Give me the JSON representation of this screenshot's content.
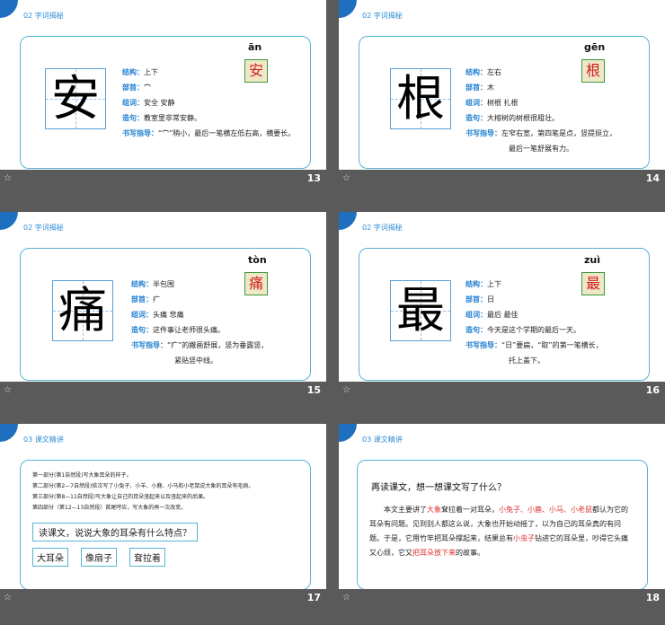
{
  "slides": [
    {
      "header": "02  字词揭秘",
      "char": "安",
      "pinyin": "ān",
      "rows": [
        {
          "label": "结构：",
          "value": "上下"
        },
        {
          "label": "部首：",
          "value": "宀"
        },
        {
          "label": "组词：",
          "value": "安全  安静"
        },
        {
          "label": "造句：",
          "value": "教室里非常安静。"
        },
        {
          "label": "书写指导：",
          "value": "“宀”稍小，最后一笔横左低右高，横要长。"
        }
      ],
      "page": "13"
    },
    {
      "header": "02  字词揭秘",
      "char": "根",
      "pinyin": "gēn",
      "rows": [
        {
          "label": "结构：",
          "value": "左右"
        },
        {
          "label": "部首：",
          "value": "木"
        },
        {
          "label": "组词：",
          "value": "树根  扎根"
        },
        {
          "label": "造句：",
          "value": "大榕树的树根很粗壮。"
        },
        {
          "label": "书写指导：",
          "value": "左窄右宽，第四笔是点，竖提挺立，"
        }
      ],
      "extra": "最后一笔舒展有力。",
      "page": "14"
    },
    {
      "header": "02  字词揭秘",
      "char": "痛",
      "pinyin": "tòn",
      "rows": [
        {
          "label": "结构：",
          "value": "半包围"
        },
        {
          "label": "部首：",
          "value": "疒"
        },
        {
          "label": "组词：",
          "value": "头痛  悲痛"
        },
        {
          "label": "造句：",
          "value": "这件事让老师很头痛。"
        },
        {
          "label": "书写指导：",
          "value": "“疒”的撇画舒展，竖为垂露竖，"
        }
      ],
      "extra": "紧贴竖中线。",
      "page": "15"
    },
    {
      "header": "02  字词揭秘",
      "char": "最",
      "pinyin": "zuì",
      "rows": [
        {
          "label": "结构：",
          "value": "上下"
        },
        {
          "label": "部首：",
          "value": "日"
        },
        {
          "label": "组词：",
          "value": "最后  最佳"
        },
        {
          "label": "造句：",
          "value": "今天是这个学期的最后一天。"
        },
        {
          "label": "书写指导：",
          "value": "“日”要扁，“取”的第一笔横长，"
        }
      ],
      "extra": "托上盖下。",
      "page": "16"
    }
  ],
  "slide17": {
    "header": "03  课文精讲",
    "parts": [
      "第一部分(第1自然段)写大象耳朵的样子。",
      "第二部分(第2—7自然段)依次写了小兔子、小羊、小鹿、小马和小老鼠说大象的耳朵有毛病。",
      "第三部分(第8—11自然段)写大象让自己的耳朵竖起来以及竖起来的后果。",
      "第四部分（第12—13自然段）首尾呼应，写大象的再一次改变。"
    ],
    "question": "读课文，说说大象的耳朵有什么特点？",
    "options": [
      "大耳朵",
      "像扇子",
      "耷拉着"
    ],
    "page": "17"
  },
  "slide18": {
    "header": "03  课文精讲",
    "question": "再读课文，想一想课文写了什么？",
    "para": [
      {
        "t": "本文主要讲了",
        "r": false
      },
      {
        "t": "大象",
        "r": true
      },
      {
        "t": "耷拉着一对耳朵，",
        "r": false
      },
      {
        "t": "小兔子、小鹿、小马、小老鼠",
        "r": true
      },
      {
        "t": "都认为它的耳朵有问题。见到别人都这么说，大象也开始动摇了，以为自己的耳朵真的有问题。于是，它用竹竿把耳朵撑起来，结果总有",
        "r": false
      },
      {
        "t": "小虫子",
        "r": true
      },
      {
        "t": "钻进它的耳朵里，吵得它头痛又心烦，它又",
        "r": false
      },
      {
        "t": "把耳朵放下来",
        "r": true
      },
      {
        "t": "的故事。",
        "r": false
      }
    ],
    "page": "18"
  }
}
